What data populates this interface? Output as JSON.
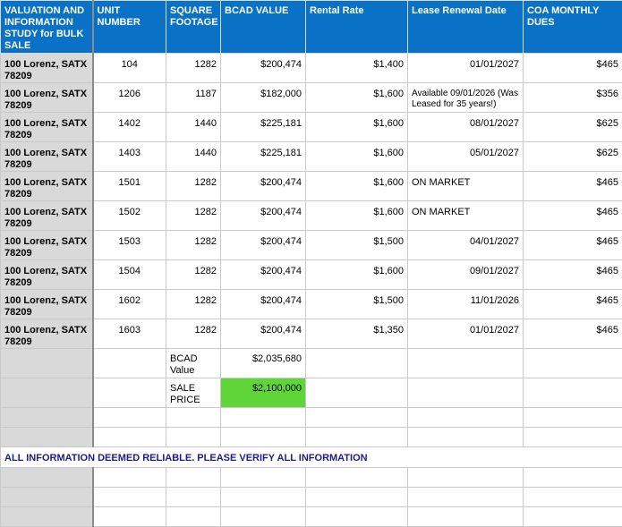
{
  "headers": [
    "VALUATION AND INFORMATION STUDY for BULK SALE",
    "UNIT NUMBER",
    "SQUARE FOOTAGE",
    "BCAD VALUE",
    "Rental Rate",
    "Lease Renewal Date",
    "COA MONTHLY DUES"
  ],
  "rows": [
    {
      "address": "100 Lorenz, SATX 78209",
      "unit": "104",
      "sqft": "1282",
      "bcad": "$200,474",
      "rent": "$1,400",
      "lease": "01/01/2027",
      "dues": "$465"
    },
    {
      "address": "100 Lorenz, SATX 78209",
      "unit": "1206",
      "sqft": "1187",
      "bcad": "$182,000",
      "rent": "$1,600",
      "lease": "Available 09/01/2026 (Was Leased for 35 years!)",
      "dues": "$356"
    },
    {
      "address": "100 Lorenz, SATX 78209",
      "unit": "1402",
      "sqft": "1440",
      "bcad": "$225,181",
      "rent": "$1,600",
      "lease": "08/01/2027",
      "dues": "$625"
    },
    {
      "address": "100 Lorenz, SATX 78209",
      "unit": "1403",
      "sqft": "1440",
      "bcad": "$225,181",
      "rent": "$1,600",
      "lease": "05/01/2027",
      "dues": "$625"
    },
    {
      "address": "100 Lorenz, SATX 78209",
      "unit": "1501",
      "sqft": "1282",
      "bcad": "$200,474",
      "rent": "$1,600",
      "lease": "ON MARKET",
      "dues": "$465"
    },
    {
      "address": "100 Lorenz, SATX 78209",
      "unit": "1502",
      "sqft": "1282",
      "bcad": "$200,474",
      "rent": "$1,600",
      "lease": "ON MARKET",
      "dues": "$465"
    },
    {
      "address": "100 Lorenz, SATX 78209",
      "unit": "1503",
      "sqft": "1282",
      "bcad": "$200,474",
      "rent": "$1,500",
      "lease": "04/01/2027",
      "dues": "$465"
    },
    {
      "address": "100 Lorenz, SATX 78209",
      "unit": "1504",
      "sqft": "1282",
      "bcad": "$200,474",
      "rent": "$1,600",
      "lease": "09/01/2027",
      "dues": "$465"
    },
    {
      "address": "100 Lorenz, SATX 78209",
      "unit": "1602",
      "sqft": "1282",
      "bcad": "$200,474",
      "rent": "$1,500",
      "lease": "11/01/2026",
      "dues": "$465"
    },
    {
      "address": "100 Lorenz, SATX 78209",
      "unit": "1603",
      "sqft": "1282",
      "bcad": "$200,474",
      "rent": "$1,350",
      "lease": "01/01/2027",
      "dues": "$465"
    }
  ],
  "summary": {
    "bcad_label": "BCAD Value",
    "bcad_total": "$2,035,680",
    "sale_label": "SALE PRICE",
    "sale_price": "$2,100,000"
  },
  "note": "ALL INFORMATION DEEMED RELIABLE. PLEASE VERIFY ALL INFORMATION",
  "colors": {
    "header_bg": "#0a72c6",
    "address_bg": "#d9d9d9",
    "sale_price_bg": "#5fd638",
    "note_text": "#1c1d8c"
  }
}
